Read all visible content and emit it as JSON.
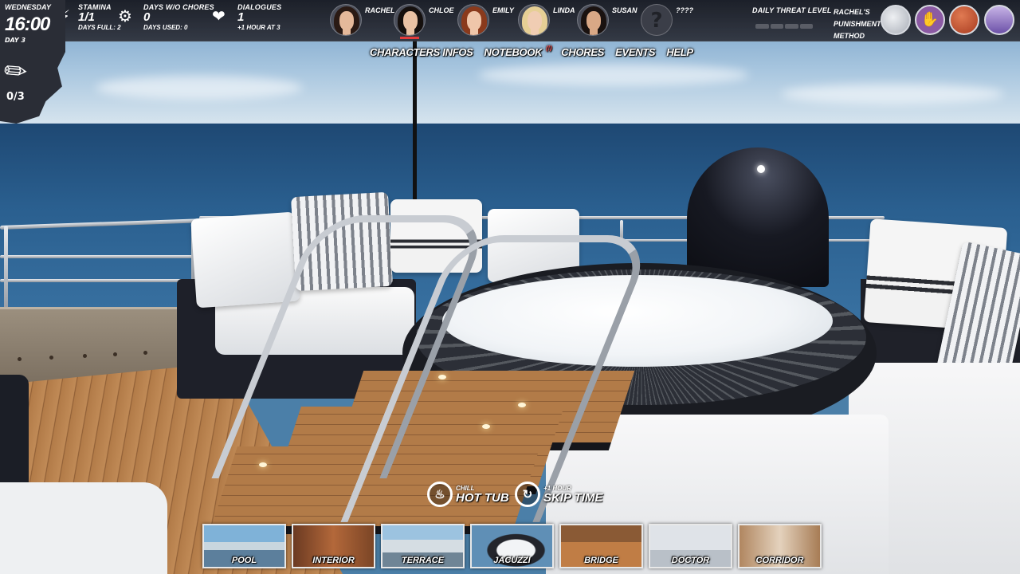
{
  "hud": {
    "day": "WEDNESDAY",
    "time": "16:00",
    "day_number": "DAY 3",
    "item_count": "0/3",
    "stamina": {
      "label": "STAMINA",
      "value": "1/1",
      "sub": "DAYS FULL: 2"
    },
    "chores": {
      "label": "DAYS W/O CHORES",
      "value": "0",
      "sub": "DAYS USED: 0"
    },
    "dialogues": {
      "label": "DIALOGUES",
      "value": "1",
      "sub": "+1 HOUR AT 3"
    }
  },
  "characters": [
    {
      "name": "RACHEL",
      "hair": "#2a1a14",
      "skin": "#e5b99a",
      "selected": false
    },
    {
      "name": "CHLOE",
      "hair": "#15100e",
      "skin": "#e9c2a4",
      "selected": true
    },
    {
      "name": "EMILY",
      "hair": "#8a3a1c",
      "skin": "#efc6aa",
      "selected": false
    },
    {
      "name": "LINDA",
      "hair": "#e6cf95",
      "skin": "#f0cdb3",
      "selected": false
    },
    {
      "name": "SUSAN",
      "hair": "#1a1210",
      "skin": "#d9a886",
      "selected": false
    },
    {
      "name": "????",
      "unknown_glyph": "?"
    }
  ],
  "threat": {
    "label": "DAILY THREAT LEVEL",
    "segments": 4,
    "filled": 0
  },
  "punishment": {
    "line1": "RACHEL'S",
    "line2": "PUNISHMENT",
    "line3": "METHOD",
    "methods": [
      {
        "icon": "butt-icon",
        "color": "#c9ccd4"
      },
      {
        "icon": "hand-icon",
        "glyph": "✋",
        "color": "#8b5aa3"
      },
      {
        "icon": "paddle-icon",
        "color": "#c6502f"
      },
      {
        "icon": "figure-icon",
        "color": "#7d63b5"
      }
    ]
  },
  "menu": {
    "characters_infos": "CHARACTERS INFOS",
    "notebook": "NOTEBOOK",
    "notebook_badge": "(!)",
    "chores": "CHORES",
    "events": "EVENTS",
    "help": "HELP"
  },
  "actions": {
    "hot_tub": {
      "small": "CHILL",
      "big": "HOT TUB"
    },
    "skip_time": {
      "small": "+1 HOUR",
      "big": "SKIP TIME"
    }
  },
  "locations": [
    {
      "id": "pool",
      "label": "POOL"
    },
    {
      "id": "interior",
      "label": "INTERIOR"
    },
    {
      "id": "terrace",
      "label": "TERRACE"
    },
    {
      "id": "jacuzzi",
      "label": "JACUZZI"
    },
    {
      "id": "bridge",
      "label": "BRIDGE"
    },
    {
      "id": "doctor",
      "label": "DOCTOR"
    },
    {
      "id": "corridor",
      "label": "CORRIDOR"
    }
  ],
  "colors": {
    "accent_red": "#e23c3c",
    "hud_bg": "#23262f"
  }
}
